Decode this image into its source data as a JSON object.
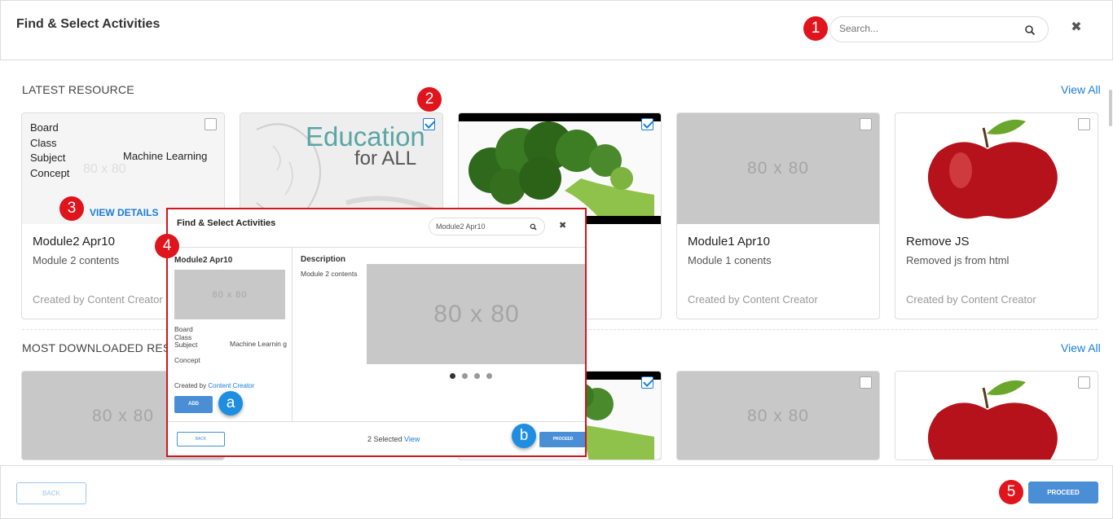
{
  "header": {
    "title": "Find & Select Activities",
    "search_placeholder": "Search...",
    "close_glyph": "✖"
  },
  "markers": [
    "1",
    "2",
    "3",
    "4",
    "5",
    "a",
    "b"
  ],
  "sections": {
    "latest": {
      "title": "LATEST RESOURCE",
      "view_all": "View All"
    },
    "most_downloaded": {
      "title": "MOST DOWNLOADED RESOURCE",
      "view_all": "View All"
    }
  },
  "placeholder_text": "80 x 80",
  "latest_cards": [
    {
      "title": "Module2 Apr10",
      "description": "Module 2 contents",
      "created_by": "Created by Content Creator",
      "checked": false,
      "meta": {
        "board": "Board",
        "class": "Class",
        "subject": "Subject",
        "subject_value": "Machine Learning",
        "concept": "Concept"
      },
      "view_details": "VIEW DETAILS"
    },
    {
      "title": "",
      "description": "",
      "created_by": "",
      "checked": true,
      "image_text_1": "Education",
      "image_text_2": "for ALL"
    },
    {
      "title": "",
      "description": "",
      "created_by": "",
      "checked": true
    },
    {
      "title": "Module1 Apr10",
      "description": "Module 1 conents",
      "created_by": "Created by Content Creator",
      "checked": false
    },
    {
      "title": "Remove JS",
      "description": "Removed js from html",
      "created_by": "Created by Content Creator",
      "checked": false
    }
  ],
  "most_downloaded_cards": [
    {
      "checked": false
    },
    {
      "checked": false
    },
    {
      "checked": true
    },
    {
      "checked": false
    },
    {
      "checked": false
    }
  ],
  "popup": {
    "title": "Find & Select Activities",
    "search_value": "Module2 Apr10",
    "close_glyph": "✖",
    "module_title": "Module2 Apr10",
    "meta": {
      "board": "Board",
      "class": "Class",
      "subject": "Subject",
      "subject_value": "Machine Learnin g",
      "concept": "Concept"
    },
    "created_prefix": "Created by",
    "created_author": "Content Creator",
    "add_label": "ADD",
    "description_heading": "Description",
    "description_text": "Module 2 contents",
    "selected_text": "2 Selected",
    "selected_link": "View",
    "back_label": "BACK",
    "proceed_label": "PROCEED",
    "carousel_active_index": 1
  },
  "footer": {
    "back_label": "BACK",
    "proceed_label": "PROCEED"
  },
  "colors": {
    "accent": "#1a7ed6",
    "marker_red": "#e0141c",
    "marker_blue": "#1f8ee0",
    "button_blue": "#4a8fd6"
  }
}
